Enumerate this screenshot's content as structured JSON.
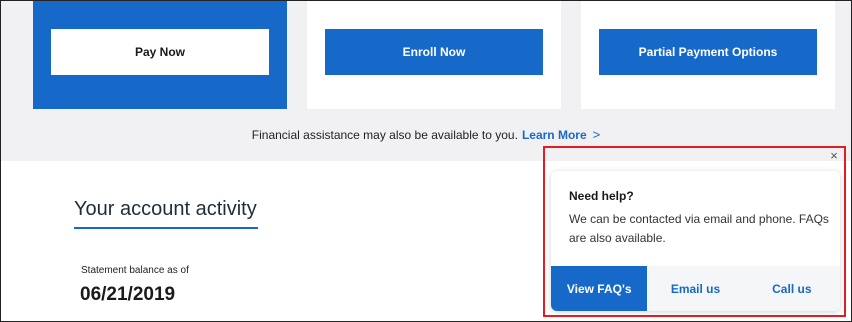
{
  "payment_options": {
    "pay_now": "Pay Now",
    "enroll_now": "Enroll Now",
    "partial_payment": "Partial Payment Options"
  },
  "assistance": {
    "text": "Financial assistance may also be available to you.",
    "link": "Learn More",
    "chevron": ">"
  },
  "account": {
    "title": "Your account activity",
    "statement_label": "Statement balance as of",
    "statement_date": "06/21/2019"
  },
  "help_popup": {
    "close": "×",
    "title": "Need help?",
    "body": "We can be contacted via email and phone. FAQs are also available.",
    "actions": [
      "View FAQ's",
      "Email us",
      "Call us"
    ]
  },
  "colors": {
    "accent": "#1769c9",
    "highlight": "#e02020",
    "band": "#f1f1f4"
  }
}
